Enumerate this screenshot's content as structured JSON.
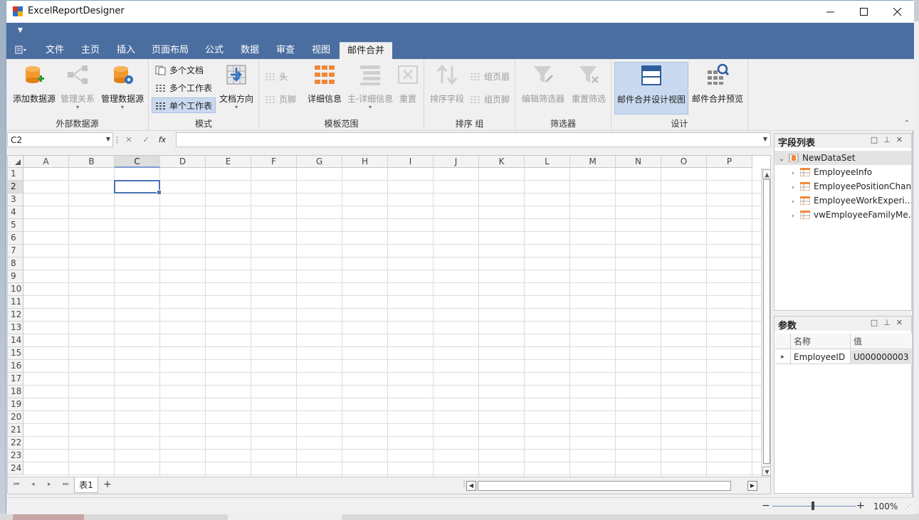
{
  "window": {
    "title": "ExcelReportDesigner"
  },
  "tabs": [
    {
      "label": "文件"
    },
    {
      "label": "主页"
    },
    {
      "label": "插入"
    },
    {
      "label": "页面布局"
    },
    {
      "label": "公式"
    },
    {
      "label": "数据"
    },
    {
      "label": "审查"
    },
    {
      "label": "视图"
    },
    {
      "label": "邮件合并"
    }
  ],
  "ribbon": {
    "groups": {
      "ext_data": "外部数据源",
      "mode": "模式",
      "template_range": "模板范围",
      "sort_group": "排序  组",
      "filter": "筛选器",
      "design": "设计"
    },
    "buttons": {
      "add_datasource": "添加数据源",
      "manage_relations": "管理关系",
      "manage_datasource": "管理数据源",
      "multi_doc": "多个文档",
      "multi_sheet": "多个工作表",
      "single_sheet": "单个工作表",
      "doc_direction": "文档方向",
      "header": "头",
      "footer": "页脚",
      "detail": "详细信息",
      "master_detail": "主-详细信息",
      "reset": "重置",
      "sort_field": "排序字段",
      "group_header": "组页眉",
      "group_footer": "组页脚",
      "edit_filter": "编辑筛选器",
      "reset_filter": "重置筛选",
      "merge_design_view": "邮件合并设计视图",
      "merge_preview": "邮件合并预览"
    }
  },
  "formula_bar": {
    "name_box": "C2",
    "formula": "",
    "fx": "fx"
  },
  "sheet": {
    "columns": [
      "A",
      "B",
      "C",
      "D",
      "E",
      "F",
      "G",
      "H",
      "I",
      "J",
      "K",
      "L",
      "M",
      "N",
      "O",
      "P"
    ],
    "rows": [
      "1",
      "2",
      "3",
      "4",
      "5",
      "6",
      "7",
      "8",
      "9",
      "10",
      "11",
      "12",
      "13",
      "14",
      "15",
      "16",
      "17",
      "18",
      "19",
      "20",
      "21",
      "22",
      "23",
      "24"
    ],
    "selected_cell": "C2",
    "tabs": [
      {
        "label": "表1"
      }
    ]
  },
  "field_list": {
    "title": "字段列表",
    "root": "NewDataSet",
    "items": [
      {
        "label": "EmployeeInfo"
      },
      {
        "label": "EmployeePositionChan..."
      },
      {
        "label": "EmployeeWorkExperi..."
      },
      {
        "label": "vwEmployeeFamilyMe..."
      }
    ]
  },
  "parameters": {
    "title": "参数",
    "headers": {
      "name": "名称",
      "value": "值"
    },
    "rows": [
      {
        "name": "EmployeeID",
        "value": "U000000003"
      }
    ]
  },
  "status": {
    "zoom": "100%"
  },
  "colors": {
    "accent": "#4b6ea0",
    "selection": "#4a73b0"
  }
}
